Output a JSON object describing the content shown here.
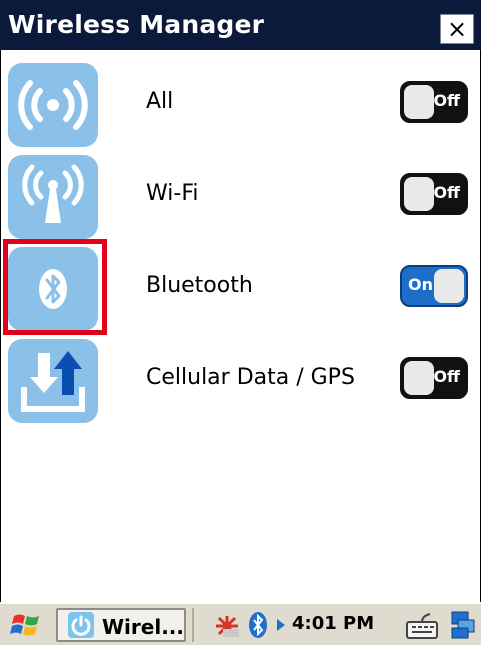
{
  "window": {
    "title": "Wireless Manager",
    "close_label": "×"
  },
  "items": [
    {
      "label": "All",
      "state": "Off",
      "icon": "broadcast-icon"
    },
    {
      "label": "Wi-Fi",
      "state": "Off",
      "icon": "wifi-antenna-icon"
    },
    {
      "label": "Bluetooth",
      "state": "On",
      "icon": "bluetooth-icon"
    },
    {
      "label": "Cellular Data / GPS",
      "state": "Off",
      "icon": "cellular-data-icon"
    }
  ],
  "taskbar": {
    "start_icon": "windows-flag-icon",
    "app_label": "Wirel...",
    "app_icon": "power-icon",
    "tray_icons": [
      "network-icon",
      "bluetooth-tray-icon",
      "expand-icon"
    ],
    "time": "4:01 PM",
    "keyboard_icon": "keyboard-icon",
    "desktop_icon": "desktop-icon"
  },
  "colors": {
    "title_bar": "#0b1a3a",
    "tile": "#8bc1e8",
    "toggle_on": "#1e6dc8",
    "toggle_off": "#111111",
    "highlight": "#e3001b"
  }
}
